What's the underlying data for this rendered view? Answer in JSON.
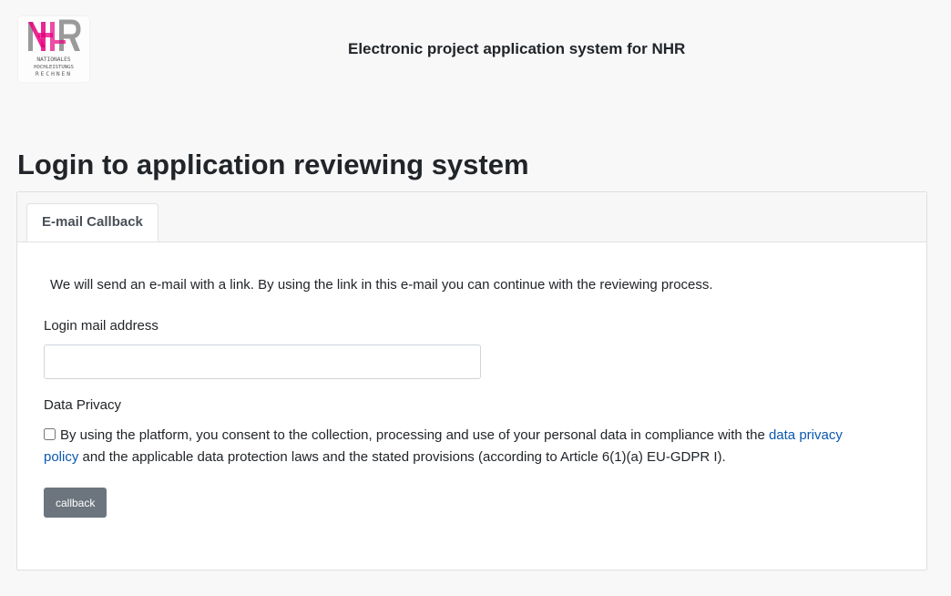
{
  "header": {
    "logo": {
      "lines": [
        "NATIONALES",
        "HOCHLEISTUNGS",
        "RECHNEN"
      ],
      "colors": {
        "magenta": "#e6007e",
        "gray": "#8a8a8a"
      }
    },
    "title": "Electronic project application system for NHR"
  },
  "page_title": "Login to application reviewing system",
  "tabs": [
    {
      "label": "E-mail Callback",
      "active": true
    }
  ],
  "form": {
    "info_text": "We will send an e-mail with a link. By using the link in this e-mail you can continue with the reviewing process.",
    "email_label": "Login mail address",
    "email_value": "",
    "privacy_heading": "Data Privacy",
    "consent_checked": false,
    "consent_text_before": "By using the platform, you consent to the collection, processing and use of your personal data in compliance with the ",
    "consent_link_text": "data privacy policy",
    "consent_text_after": " and the applicable data protection laws and the stated provisions (according to Article 6(1)(a) EU-GDPR I).",
    "submit_label": "callback"
  },
  "colors": {
    "background": "#f8f8f8",
    "link": "#0b58b0",
    "button": "#6c757d"
  }
}
